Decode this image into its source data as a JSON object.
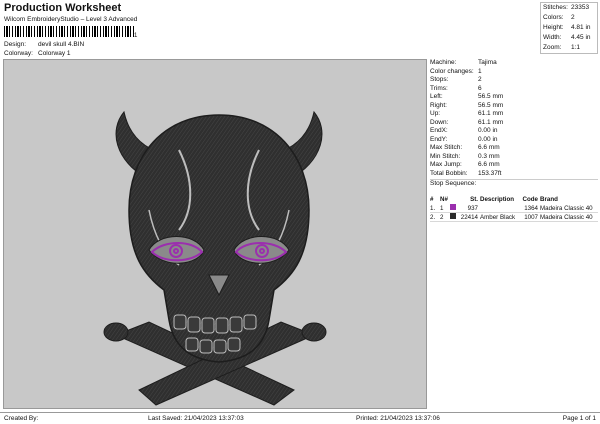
{
  "header": {
    "title": "Production Worksheet",
    "subtitle": "Wilcom EmbroideryStudio – Level 3 Advanced",
    "barcode_suffix": "1",
    "design_label": "Design:",
    "design_value": "devil skull 4.BIN",
    "colorway_label": "Colorway:",
    "colorway_value": "Colorway 1"
  },
  "stats": [
    {
      "label": "Stitches:",
      "value": "23353"
    },
    {
      "label": "Colors:",
      "value": "2"
    },
    {
      "label": "Height:",
      "value": "4.81 in"
    },
    {
      "label": "Width:",
      "value": "4.45 in"
    },
    {
      "label": "Zoom:",
      "value": "1:1"
    }
  ],
  "machine_info": [
    {
      "label": "Machine:",
      "value": "Tajima"
    },
    {
      "label": "Color changes:",
      "value": "1"
    },
    {
      "label": "Stops:",
      "value": "2"
    },
    {
      "label": "Trims:",
      "value": "6"
    },
    {
      "label": "Left:",
      "value": "56.5 mm"
    },
    {
      "label": "Right:",
      "value": "56.5 mm"
    },
    {
      "label": "Up:",
      "value": "61.1 mm"
    },
    {
      "label": "Down:",
      "value": "61.1 mm"
    },
    {
      "label": "EndX:",
      "value": "0.00 in"
    },
    {
      "label": "EndY:",
      "value": "0.00 in"
    },
    {
      "label": "Max Stitch:",
      "value": "6.6 mm"
    },
    {
      "label": "Min Stitch:",
      "value": "0.3 mm"
    },
    {
      "label": "Max Jump:",
      "value": "6.6 mm"
    },
    {
      "label": "Total Bobbin:",
      "value": "153.37ft"
    }
  ],
  "stop_sequence": {
    "title": "Stop Sequence:",
    "columns": [
      "#",
      "N#",
      "",
      "St.",
      "Description",
      "Code",
      "Brand"
    ],
    "rows": [
      {
        "num": "1.",
        "n": "1",
        "color": "#9b2fae",
        "st": "937",
        "desc": "",
        "code": "1364",
        "brand": "Madeira Classic 40"
      },
      {
        "num": "2.",
        "n": "2",
        "color": "#2b2b2b",
        "st": "22414",
        "desc": "Amber Black",
        "code": "1007",
        "brand": "Madeira Classic 40"
      }
    ]
  },
  "footer": {
    "created_by": "Created By:",
    "last_saved": "Last Saved: 21/04/2023 13:37:03",
    "printed": "Printed: 21/04/2023 13:37:06",
    "page": "Page 1 of 1"
  },
  "colors": {
    "canvas_bg": "#c8c8c8",
    "thread_black": "#2b2b2b",
    "thread_purple": "#9b2fae"
  }
}
